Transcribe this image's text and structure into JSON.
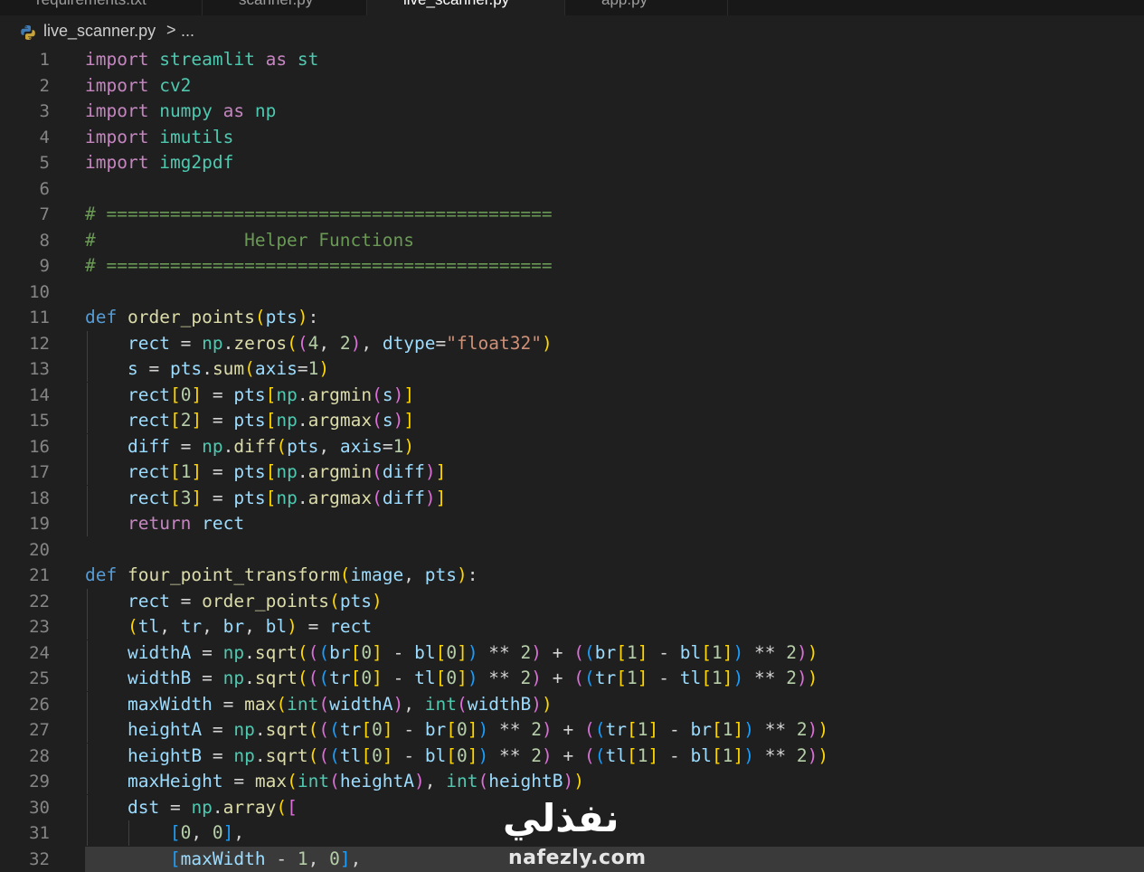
{
  "tabs": [
    "requirements.txt",
    "scanner.py",
    "live_scanner.py",
    "app.py"
  ],
  "breadcrumb": {
    "file": "live_scanner.py",
    "separator": ">",
    "more": "..."
  },
  "watermark": {
    "arabic": "نفذلي",
    "latin": "nafezly.com"
  },
  "line_numbers": [
    "1",
    "2",
    "3",
    "4",
    "5",
    "6",
    "7",
    "8",
    "9",
    "10",
    "11",
    "12",
    "13",
    "14",
    "15",
    "16",
    "17",
    "18",
    "19",
    "20",
    "21",
    "22",
    "23",
    "24",
    "25",
    "26",
    "27",
    "28",
    "29",
    "30",
    "31",
    "32"
  ],
  "code_lines": [
    "import streamlit as st",
    "import cv2",
    "import numpy as np",
    "import imutils",
    "import img2pdf",
    "",
    "# ==========================================",
    "#              Helper Functions",
    "# ==========================================",
    "",
    "def order_points(pts):",
    "    rect = np.zeros((4, 2), dtype=\"float32\")",
    "    s = pts.sum(axis=1)",
    "    rect[0] = pts[np.argmin(s)]",
    "    rect[2] = pts[np.argmax(s)]",
    "    diff = np.diff(pts, axis=1)",
    "    rect[1] = pts[np.argmin(diff)]",
    "    rect[3] = pts[np.argmax(diff)]",
    "    return rect",
    "",
    "def four_point_transform(image, pts):",
    "    rect = order_points(pts)",
    "    (tl, tr, br, bl) = rect",
    "    widthA = np.sqrt(((br[0] - bl[0]) ** 2) + ((br[1] - bl[1]) ** 2))",
    "    widthB = np.sqrt(((tr[0] - tl[0]) ** 2) + ((tr[1] - tl[1]) ** 2))",
    "    maxWidth = max(int(widthA), int(widthB))",
    "    heightA = np.sqrt(((tr[0] - br[0]) ** 2) + ((tr[1] - br[1]) ** 2))",
    "    heightB = np.sqrt(((tl[0] - bl[0]) ** 2) + ((tl[1] - bl[1]) ** 2))",
    "    maxHeight = max(int(heightA), int(heightB))",
    "    dst = np.array([",
    "        [0, 0],",
    "        [maxWidth - 1, 0],"
  ],
  "colors": {
    "background": "#1f1f1f",
    "keyword_import": "#c586c0",
    "keyword_def": "#569cd6",
    "module": "#4ec9b0",
    "function": "#dcdcaa",
    "variable": "#9cdcfe",
    "number": "#b5cea8",
    "string": "#ce9178",
    "comment": "#6a9955"
  }
}
